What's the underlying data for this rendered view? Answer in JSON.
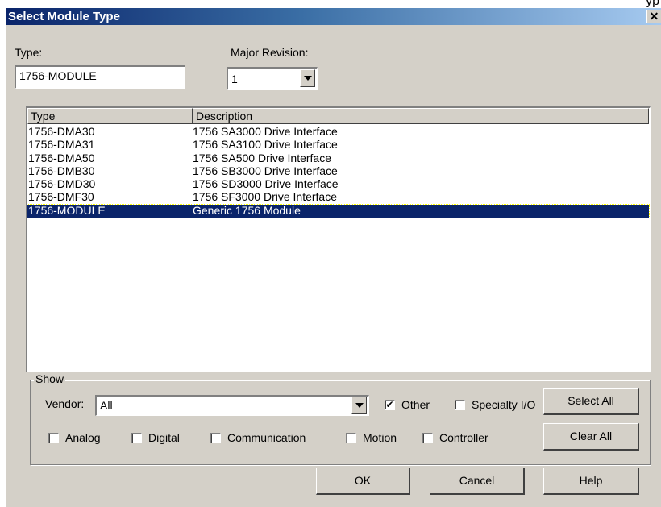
{
  "corner_text": "yp",
  "window": {
    "title": "Select Module Type",
    "close_glyph": "✕"
  },
  "type_field": {
    "label": "Type:",
    "value": "1756-MODULE"
  },
  "major_revision": {
    "label": "Major Revision:",
    "value": "1"
  },
  "module_list": {
    "columns": [
      "Type",
      "Description"
    ],
    "rows": [
      {
        "type": "1756-DMA30",
        "description": "1756 SA3000 Drive Interface"
      },
      {
        "type": "1756-DMA31",
        "description": "1756 SA3100 Drive Interface"
      },
      {
        "type": "1756-DMA50",
        "description": "1756 SA500 Drive Interface"
      },
      {
        "type": "1756-DMB30",
        "description": "1756 SB3000 Drive Interface"
      },
      {
        "type": "1756-DMD30",
        "description": "1756 SD3000 Drive Interface"
      },
      {
        "type": "1756-DMF30",
        "description": "1756 SF3000 Drive Interface"
      },
      {
        "type": "1756-MODULE",
        "description": "Generic 1756 Module"
      }
    ],
    "selected_index": 6
  },
  "show_group": {
    "title": "Show",
    "vendor_label": "Vendor:",
    "vendor_value": "All",
    "checkboxes": {
      "other": {
        "label": "Other",
        "checked": true
      },
      "specialty_io": {
        "label": "Specialty I/O",
        "checked": false
      },
      "analog": {
        "label": "Analog",
        "checked": false
      },
      "digital": {
        "label": "Digital",
        "checked": false
      },
      "communication": {
        "label": "Communication",
        "checked": false
      },
      "motion": {
        "label": "Motion",
        "checked": false
      },
      "controller": {
        "label": "Controller",
        "checked": false
      }
    },
    "select_all_label": "Select All",
    "clear_all_label": "Clear All"
  },
  "buttons": {
    "ok": "OK",
    "cancel": "Cancel",
    "help": "Help"
  },
  "colors": {
    "titlebar": "#0a246a",
    "face": "#d4d0c8",
    "selection": "#0a246a"
  }
}
